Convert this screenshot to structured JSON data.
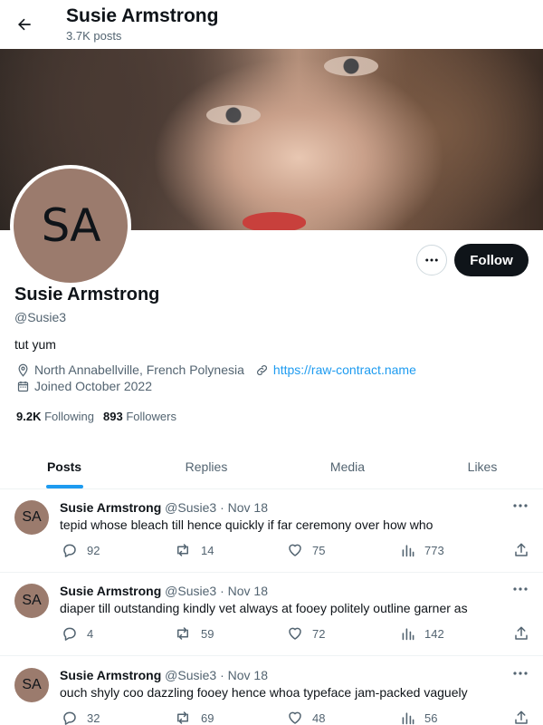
{
  "header": {
    "name": "Susie Armstrong",
    "post_count": "3.7K posts"
  },
  "profile": {
    "avatar_initials": "SA",
    "name": "Susie Armstrong",
    "handle": "@Susie3",
    "bio": "tut yum",
    "location": "North Annabellville, French Polynesia",
    "website": "https://raw-contract.name",
    "joined": "Joined October 2022",
    "following_count": "9.2K",
    "following_label": "Following",
    "followers_count": "893",
    "followers_label": "Followers",
    "follow_button": "Follow"
  },
  "tabs": [
    "Posts",
    "Replies",
    "Media",
    "Likes"
  ],
  "active_tab": "Posts",
  "posts": [
    {
      "avatar": "SA",
      "name": "Susie Armstrong",
      "handle": "@Susie3",
      "date": "· Nov 18",
      "text": "tepid whose bleach till hence quickly if far ceremony over how who",
      "replies": "92",
      "reposts": "14",
      "likes": "75",
      "views": "773"
    },
    {
      "avatar": "SA",
      "name": "Susie Armstrong",
      "handle": "@Susie3",
      "date": "· Nov 18",
      "text": "diaper till outstanding kindly vet always at fooey politely outline garner as",
      "replies": "4",
      "reposts": "59",
      "likes": "72",
      "views": "142"
    },
    {
      "avatar": "SA",
      "name": "Susie Armstrong",
      "handle": "@Susie3",
      "date": "· Nov 18",
      "text": "ouch shyly coo dazzling fooey hence whoa typeface jam-packed vaguely",
      "replies": "32",
      "reposts": "69",
      "likes": "48",
      "views": "56"
    }
  ],
  "colors": {
    "accent": "#1d9bf0",
    "text_primary": "#0f1419",
    "text_secondary": "#536471",
    "avatar_bg": "#9b7b6d",
    "follow_button_bg": "#0f1419"
  }
}
